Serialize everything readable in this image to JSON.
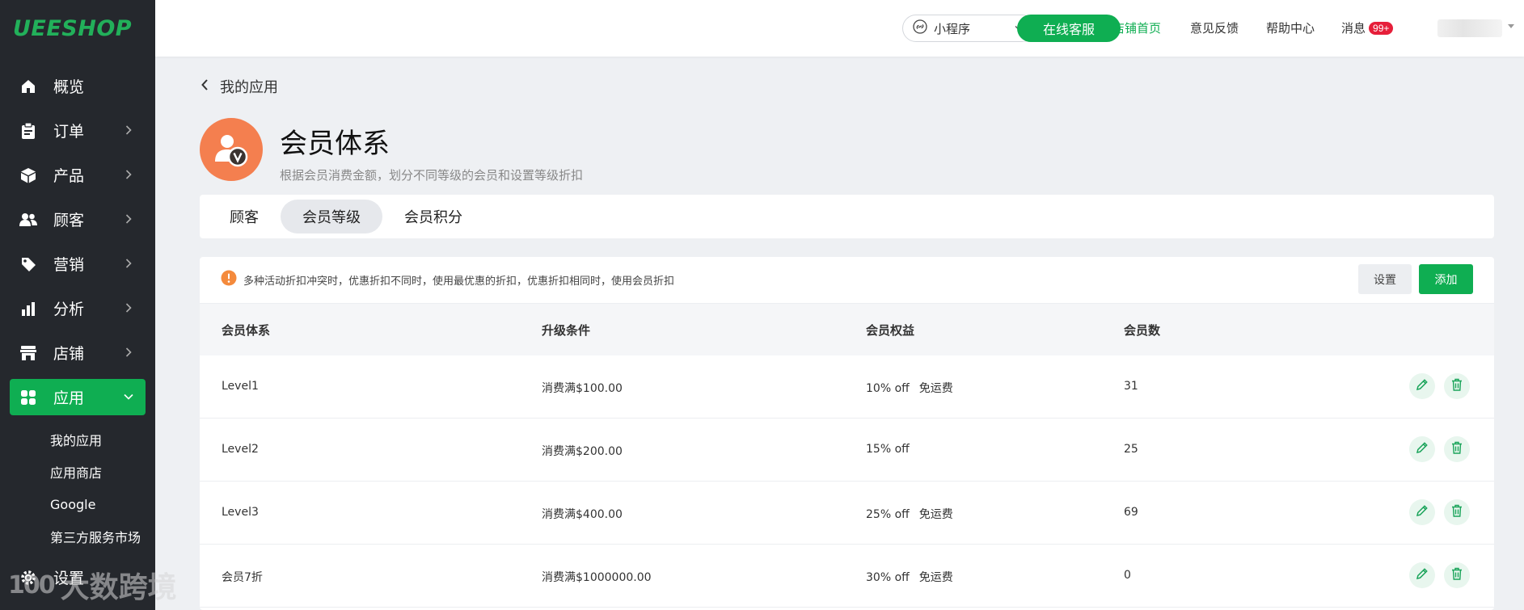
{
  "brand": {
    "logo_text": "UEESHOP",
    "accent": "#0fae52"
  },
  "sidebar": {
    "items": [
      {
        "label": "概览",
        "icon": "home-icon",
        "has_chevron": false
      },
      {
        "label": "订单",
        "icon": "clipboard-icon",
        "has_chevron": true
      },
      {
        "label": "产品",
        "icon": "cube-icon",
        "has_chevron": true
      },
      {
        "label": "顾客",
        "icon": "users-icon",
        "has_chevron": true
      },
      {
        "label": "营销",
        "icon": "tag-icon",
        "has_chevron": true
      },
      {
        "label": "分析",
        "icon": "bar-chart-icon",
        "has_chevron": true
      },
      {
        "label": "店铺",
        "icon": "store-icon",
        "has_chevron": true
      },
      {
        "label": "应用",
        "icon": "apps-grid-icon",
        "has_chevron": true,
        "active": true
      }
    ],
    "sub_items": [
      "我的应用",
      "应用商店",
      "Google",
      "第三方服务市场"
    ],
    "settings_label": "设置"
  },
  "topbar": {
    "mini_program": "小程序",
    "online_service": "在线客服",
    "store_home": "店铺首页",
    "feedback": "意见反馈",
    "help_center": "帮助中心",
    "messages": "消息",
    "messages_badge": "99+"
  },
  "page": {
    "back_label": "我的应用",
    "title": "会员体系",
    "description": "根据会员消费金额，划分不同等级的会员和设置等级折扣"
  },
  "tabs": [
    {
      "label": "顾客",
      "active": false
    },
    {
      "label": "会员等级",
      "active": true
    },
    {
      "label": "会员积分",
      "active": false
    }
  ],
  "notice": {
    "text": "多种活动折扣冲突时，优惠折扣不同时，使用最优惠的折扣，优惠折扣相同时，使用会员折扣",
    "settings_label": "设置",
    "add_label": "添加"
  },
  "table": {
    "headers": [
      "会员体系",
      "升级条件",
      "会员权益",
      "会员数"
    ],
    "rows": [
      {
        "name": "Level1",
        "condition": "消费满$100.00",
        "discount": "10% off",
        "shipping": "免运费",
        "members": "31"
      },
      {
        "name": "Level2",
        "condition": "消费满$200.00",
        "discount": "15% off",
        "shipping": "",
        "members": "25"
      },
      {
        "name": "Level3",
        "condition": "消费满$400.00",
        "discount": "25% off",
        "shipping": "免运费",
        "members": "69"
      },
      {
        "name": "会员7折",
        "condition": "消费满$1000000.00",
        "discount": "30% off",
        "shipping": "免运费",
        "members": "0"
      }
    ]
  },
  "watermark": {
    "mark": "100",
    "text": "大数跨境"
  }
}
